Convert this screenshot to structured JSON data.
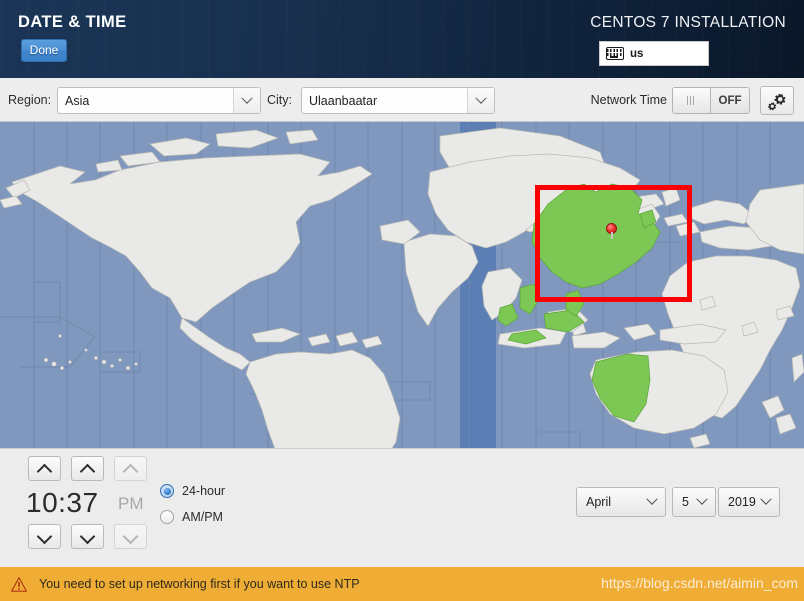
{
  "header": {
    "title": "DATE & TIME",
    "done_label": "Done",
    "install_title": "CENTOS 7 INSTALLATION",
    "keyboard_layout": "us",
    "keyboard_icon": "keyboard-icon"
  },
  "toolbar": {
    "region_label": "Region:",
    "region_value": "Asia",
    "city_label": "City:",
    "city_value": "Ulaanbaatar",
    "network_time_label": "Network Time",
    "network_time_state": "OFF",
    "settings_icon": "gear-icon"
  },
  "map": {
    "ocean_color": "#8098bd",
    "land_color": "#e9e9e7",
    "highlight_color": "#7dc855",
    "highlight_ocean_color": "#5b7fb5",
    "annotation_box_color": "#fb0000",
    "pin_color": "#ef3434",
    "pin_icon": "map-pin-icon"
  },
  "time": {
    "hour_up": "▲",
    "minute_up": "▲",
    "ampm_up": "▲",
    "hour_down": "▼",
    "minute_down": "▼",
    "ampm_down": "▼",
    "clock_value": "10:37",
    "ampm_value": "PM",
    "format_options": [
      {
        "label": "24-hour",
        "selected": true
      },
      {
        "label": "AM/PM",
        "selected": false
      }
    ]
  },
  "date": {
    "month": "April",
    "day": "5",
    "year": "2019"
  },
  "warning": {
    "icon": "warning-triangle-icon",
    "text": "You need to set up networking first if you want to use NTP",
    "watermark": "https://blog.csdn.net/aimin_com",
    "background_color": "#f0ad36"
  }
}
